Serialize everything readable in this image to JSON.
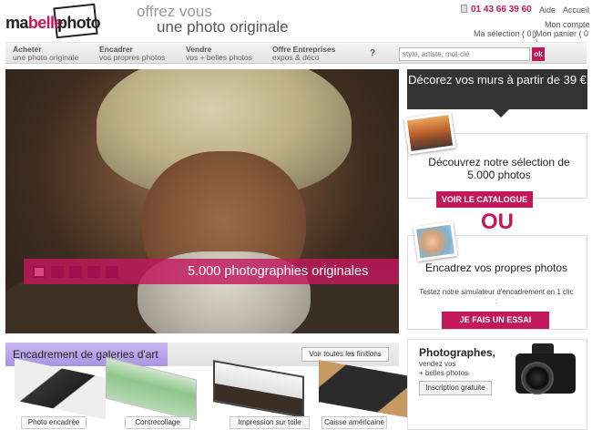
{
  "header": {
    "logo": {
      "part1": "ma",
      "part2": "belle",
      "part3": "photo"
    },
    "tagline_line1": "offrez vous",
    "tagline_line2": "une photo originale",
    "phone": "01 43 66 39 60",
    "links": {
      "aide": "Aide",
      "accueil": "Accueil",
      "compte": "Mon compte",
      "selection": "Ma sélection ( 0 )",
      "separator": "|",
      "panier": "Mon panier ( 0 )"
    }
  },
  "nav": {
    "items": [
      {
        "title": "Acheter",
        "subtitle": "une photo originale"
      },
      {
        "title": "Encadrer",
        "subtitle": "vos propres photos"
      },
      {
        "title": "Vendre",
        "subtitle": "vos + belles photos"
      },
      {
        "title": "Offre Entreprises",
        "subtitle": "expos & déco"
      }
    ],
    "help": "?",
    "search": {
      "placeholder": "style, artiste, mot-clé",
      "button": "ok"
    }
  },
  "hero": {
    "caption": "5.000 photographies originales",
    "slide_count": 5,
    "active_slide": 1
  },
  "sidebar": {
    "promo": "Décorez vos murs à partir de 39 €",
    "catalogue_text": "Découvrez notre sélection de 5.000 photos",
    "catalogue_button": "VOIR LE CATALOGUE",
    "or_text": "OU",
    "encadrez_title": "Encadrez vos propres photos",
    "encadrez_sub": "Testez notre simulateur d'encadrement en 1 clic :",
    "essai_button": "JE FAIS UN ESSAI"
  },
  "gallery": {
    "title": "Encadrement de galeries d'art",
    "all_button": "Voir toutes les finitions",
    "items": [
      {
        "label": "Photo encadrée"
      },
      {
        "label": "Contrecollage"
      },
      {
        "label": "Impression sur toile"
      },
      {
        "label": "Caisse américaine"
      }
    ]
  },
  "photographers": {
    "title": "Photographes,",
    "sub_line1": "vendez vos",
    "sub_line2": "+ belles photos",
    "button": "Inscription gratuite"
  },
  "colors": {
    "accent": "#c2185b",
    "dark": "#333333",
    "gallery_title_bg": "#b9a6ea"
  }
}
